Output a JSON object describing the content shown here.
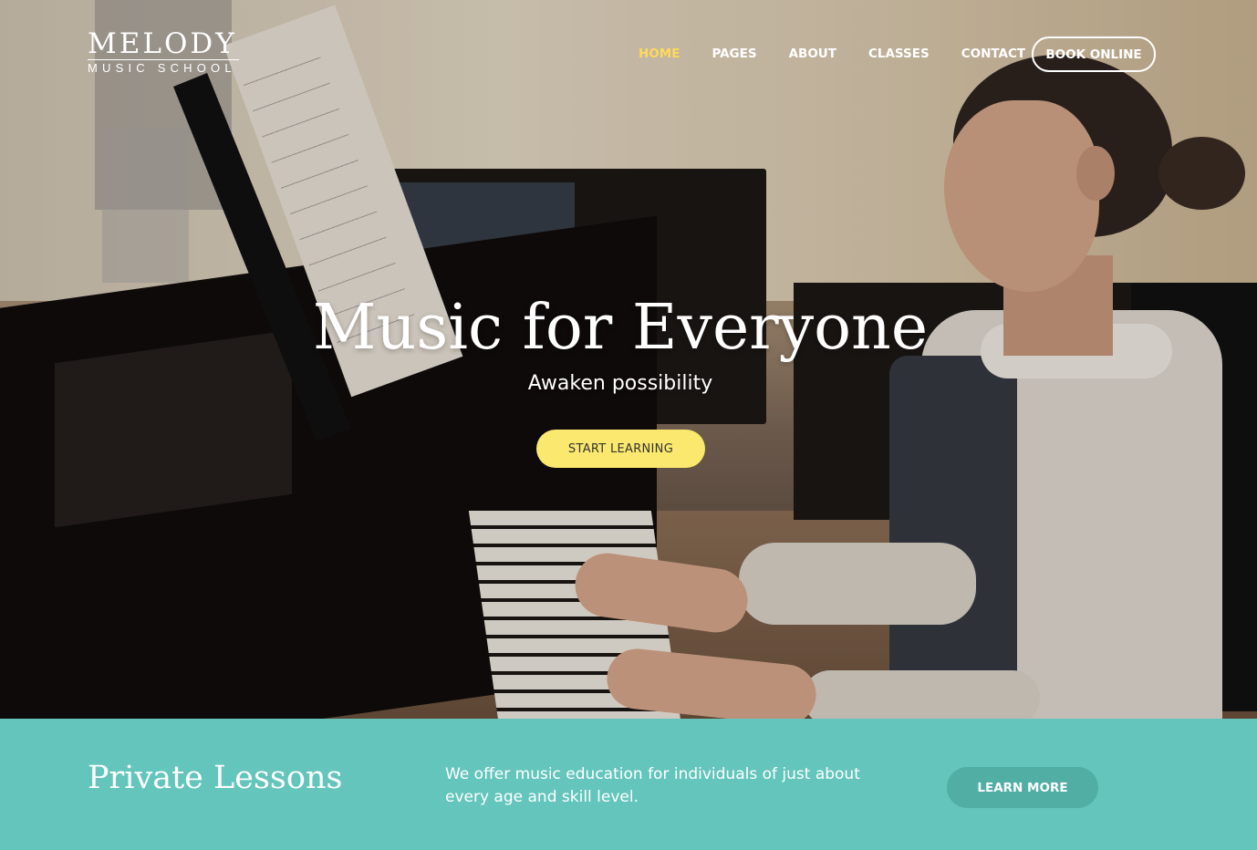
{
  "logo": {
    "main": "MELODY",
    "sub": "MUSIC SCHOOL"
  },
  "nav": {
    "items": [
      {
        "label": "HOME",
        "active": true
      },
      {
        "label": "PAGES"
      },
      {
        "label": "ABOUT"
      },
      {
        "label": "CLASSES"
      },
      {
        "label": "CONTACT"
      }
    ],
    "book_label": "BOOK ONLINE"
  },
  "hero": {
    "title": "Music for Everyone",
    "subtitle": "Awaken possibility",
    "cta_label": "START LEARNING"
  },
  "band": {
    "title": "Private Lessons",
    "text": "We offer music education for individuals of just about every age and skill level.",
    "cta_label": "LEARN MORE"
  },
  "colors": {
    "accent_yellow": "#fbe86e",
    "active_nav": "#ffd95a",
    "band_teal": "#63c5bc",
    "band_button": "#50aea5"
  }
}
